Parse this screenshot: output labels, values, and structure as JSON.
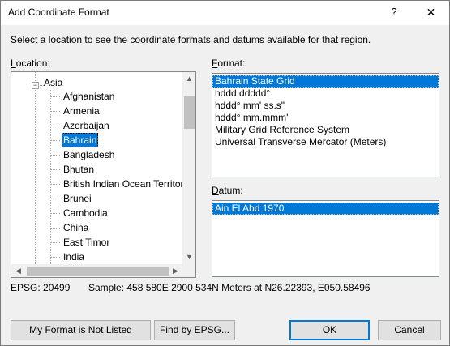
{
  "window": {
    "title": "Add Coordinate Format",
    "help_glyph": "?",
    "close_glyph": "✕"
  },
  "instruction": "Select a location to see the coordinate formats and datums available for that region.",
  "location": {
    "label_prefix": "L",
    "label_rest": "ocation:",
    "root": {
      "label": "Asia",
      "expander_glyph": "−"
    },
    "items": [
      {
        "label": "Afghanistan",
        "selected": false
      },
      {
        "label": "Armenia",
        "selected": false
      },
      {
        "label": "Azerbaijan",
        "selected": false
      },
      {
        "label": "Bahrain",
        "selected": true
      },
      {
        "label": "Bangladesh",
        "selected": false
      },
      {
        "label": "Bhutan",
        "selected": false
      },
      {
        "label": "British Indian Ocean Territor",
        "selected": false
      },
      {
        "label": "Brunei",
        "selected": false
      },
      {
        "label": "Cambodia",
        "selected": false
      },
      {
        "label": "China",
        "selected": false
      },
      {
        "label": "East Timor",
        "selected": false
      },
      {
        "label": "India",
        "selected": false
      }
    ],
    "scroll": {
      "up": "▲",
      "down": "▼",
      "left": "◀",
      "right": "▶"
    }
  },
  "format": {
    "label_prefix": "F",
    "label_rest": "ormat:",
    "items": [
      {
        "label": "Bahrain State Grid",
        "selected": true
      },
      {
        "label": "hddd.ddddd°",
        "selected": false
      },
      {
        "label": "hddd° mm' ss.s\"",
        "selected": false
      },
      {
        "label": "hddd° mm.mmm'",
        "selected": false
      },
      {
        "label": "Military Grid Reference System",
        "selected": false
      },
      {
        "label": "Universal Transverse Mercator (Meters)",
        "selected": false
      }
    ]
  },
  "datum": {
    "label_prefix": "D",
    "label_rest": "atum:",
    "items": [
      {
        "label": "Ain El Abd 1970",
        "selected": true
      }
    ]
  },
  "status": {
    "epsg": "EPSG: 20499",
    "sample": "Sample: 458 580E  2900 534N Meters at N26.22393, E050.58496"
  },
  "buttons": {
    "not_listed": "My Format is Not Listed",
    "find_epsg": "Find by EPSG...",
    "ok": "OK",
    "cancel": "Cancel"
  },
  "colors": {
    "selection": "#0078d7",
    "default_button_border": "#0078d7"
  }
}
